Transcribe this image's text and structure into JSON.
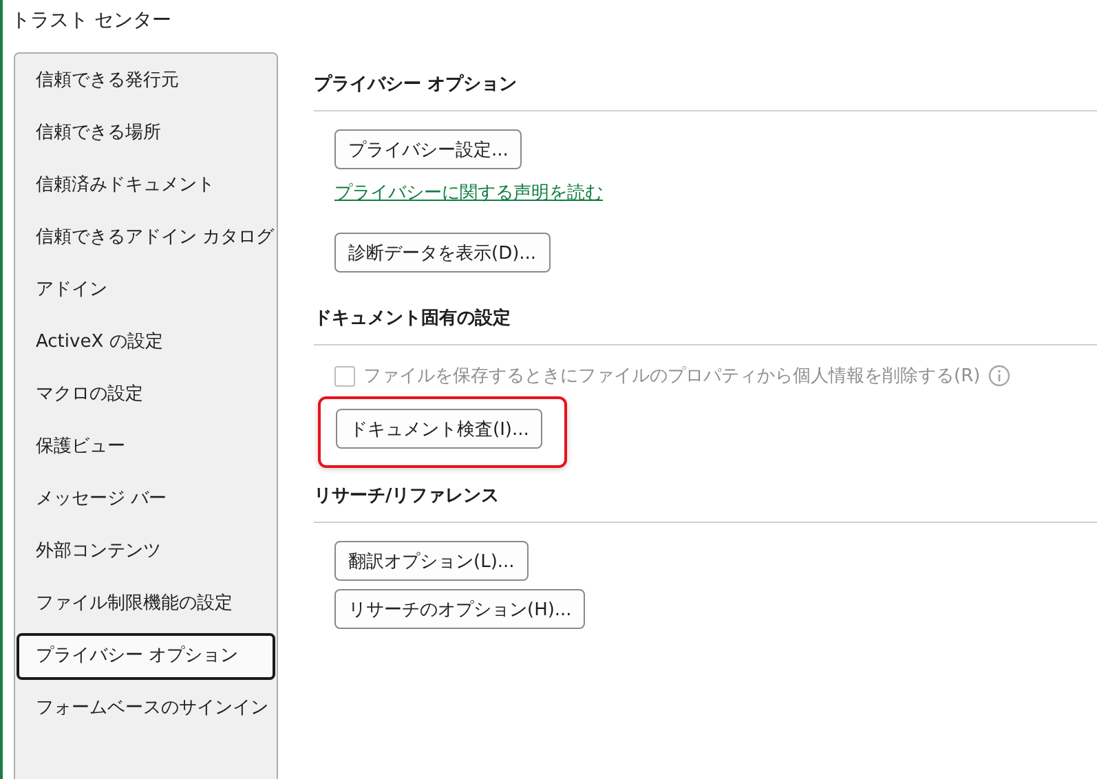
{
  "window": {
    "title": "トラスト センター"
  },
  "sidebar": {
    "items": [
      {
        "label": "信頼できる発行元",
        "selected": false
      },
      {
        "label": "信頼できる場所",
        "selected": false
      },
      {
        "label": "信頼済みドキュメント",
        "selected": false
      },
      {
        "label": "信頼できるアドイン カタログ",
        "selected": false
      },
      {
        "label": "アドイン",
        "selected": false
      },
      {
        "label": "ActiveX の設定",
        "selected": false
      },
      {
        "label": "マクロの設定",
        "selected": false
      },
      {
        "label": "保護ビュー",
        "selected": false
      },
      {
        "label": "メッセージ バー",
        "selected": false
      },
      {
        "label": "外部コンテンツ",
        "selected": false
      },
      {
        "label": "ファイル制限機能の設定",
        "selected": false
      },
      {
        "label": "プライバシー オプション",
        "selected": true
      },
      {
        "label": "フォームベースのサインイン",
        "selected": false
      }
    ]
  },
  "sections": [
    {
      "heading": "プライバシー オプション",
      "items": [
        {
          "kind": "button",
          "label": "プライバシー設定..."
        },
        {
          "kind": "link",
          "label": "プライバシーに関する声明を読む"
        },
        {
          "kind": "button",
          "label": "診断データを表示(D)..."
        }
      ]
    },
    {
      "heading": "ドキュメント固有の設定",
      "items": [
        {
          "kind": "checkbox",
          "label": "ファイルを保存するときにファイルのプロパティから個人情報を削除する(R)",
          "checked": false,
          "disabled": true
        },
        {
          "kind": "button",
          "label": "ドキュメント検査(I)...",
          "highlighted": true
        }
      ]
    },
    {
      "heading": "リサーチ/リファレンス",
      "items": [
        {
          "kind": "button",
          "label": "翻訳オプション(L)..."
        },
        {
          "kind": "button",
          "label": "リサーチのオプション(H)..."
        }
      ]
    }
  ]
}
